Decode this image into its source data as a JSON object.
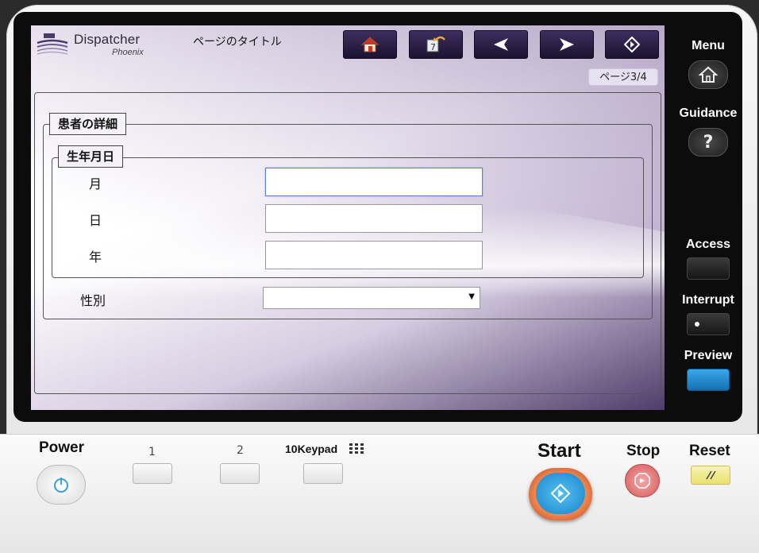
{
  "header": {
    "logo_name": "Dispatcher",
    "logo_sub": "Phoenix",
    "page_title": "ページのタイトル",
    "page_indicator": "ページ3/4"
  },
  "nav_buttons": [
    {
      "name": "home-button",
      "icon": "home-icon"
    },
    {
      "name": "history-button",
      "icon": "history-back-icon"
    },
    {
      "name": "prev-button",
      "icon": "arrow-left-icon"
    },
    {
      "name": "next-button",
      "icon": "arrow-right-icon"
    },
    {
      "name": "start-job-button",
      "icon": "start-diamond-icon"
    }
  ],
  "form": {
    "patient_section": "患者の詳細",
    "dob_section": "生年月日",
    "month_label": "月",
    "day_label": "日",
    "year_label": "年",
    "gender_label": "性別",
    "month_value": "",
    "day_value": "",
    "year_value": "",
    "gender_value": ""
  },
  "side_keys": {
    "menu": "Menu",
    "guidance": "Guidance",
    "access": "Access",
    "interrupt": "Interrupt",
    "preview": "Preview",
    "guidance_glyph": "?"
  },
  "bottom_keys": {
    "power": "Power",
    "key1": "1",
    "key2": "2",
    "keypad": "10Keypad",
    "start": "Start",
    "stop": "Stop",
    "reset": "Reset"
  },
  "colors": {
    "nav_button": "#2a1f45",
    "preview_key": "#1e8fd6",
    "start_key": "#2aa0e0",
    "stop_key": "#e07a7a",
    "reset_key": "#f3ef9a"
  }
}
